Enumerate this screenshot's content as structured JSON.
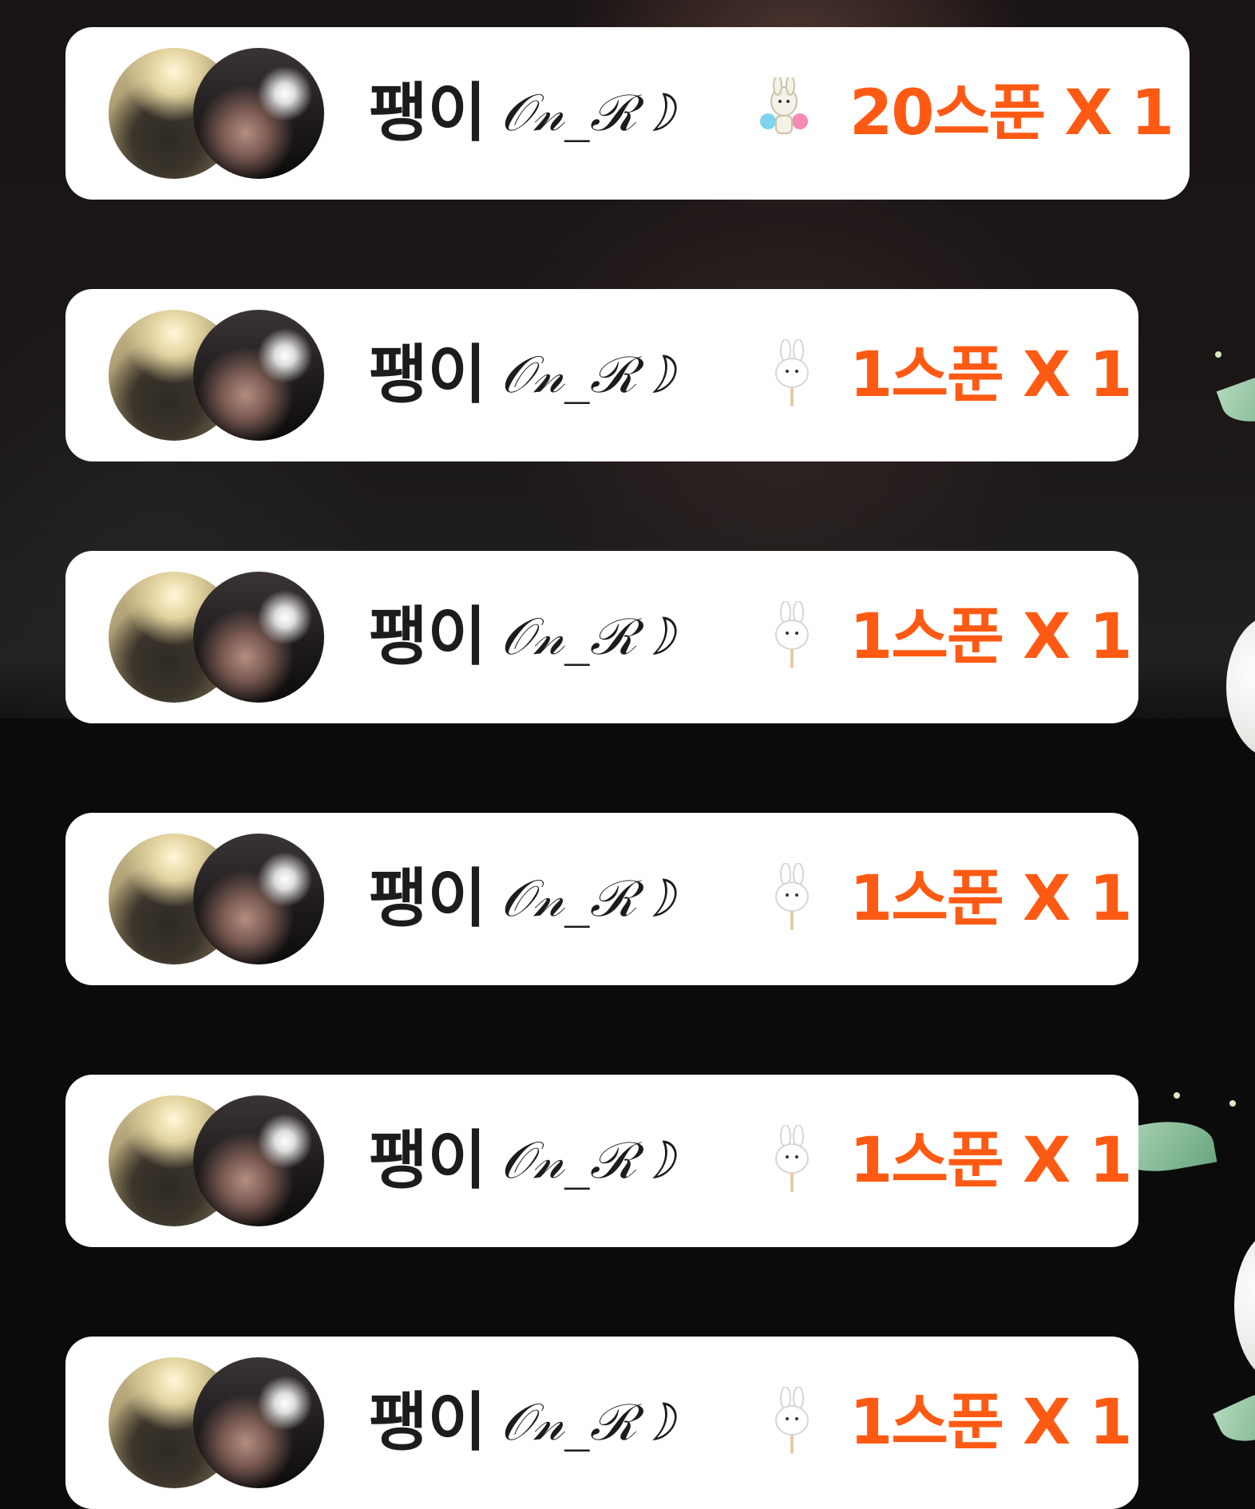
{
  "colors": {
    "card_background": "#ffffff",
    "nickname_text": "#1c1c1c",
    "gift_amount_text": "#ff5a14",
    "stream_background": "#0b0b0c"
  },
  "gift_feed": [
    {
      "nickname": "팽이",
      "nickname_suffix": "𝒪𝓃_ℛ☽",
      "gift_icon": "bunny-balloons-sticker-icon",
      "gift_amount": "20스푼 X 1"
    },
    {
      "nickname": "팽이",
      "nickname_suffix": "𝒪𝓃_ℛ☽",
      "gift_icon": "bunny-lollipop-sticker-icon",
      "gift_amount": "1스푼 X 1"
    },
    {
      "nickname": "팽이",
      "nickname_suffix": "𝒪𝓃_ℛ☽",
      "gift_icon": "bunny-lollipop-sticker-icon",
      "gift_amount": "1스푼 X 1"
    },
    {
      "nickname": "팽이",
      "nickname_suffix": "𝒪𝓃_ℛ☽",
      "gift_icon": "bunny-lollipop-sticker-icon",
      "gift_amount": "1스푼 X 1"
    },
    {
      "nickname": "팽이",
      "nickname_suffix": "𝒪𝓃_ℛ☽",
      "gift_icon": "bunny-lollipop-sticker-icon",
      "gift_amount": "1스푼 X 1"
    },
    {
      "nickname": "팽이",
      "nickname_suffix": "𝒪𝓃_ℛ☽",
      "gift_icon": "bunny-lollipop-sticker-icon",
      "gift_amount": "1스푼 X 1"
    }
  ]
}
